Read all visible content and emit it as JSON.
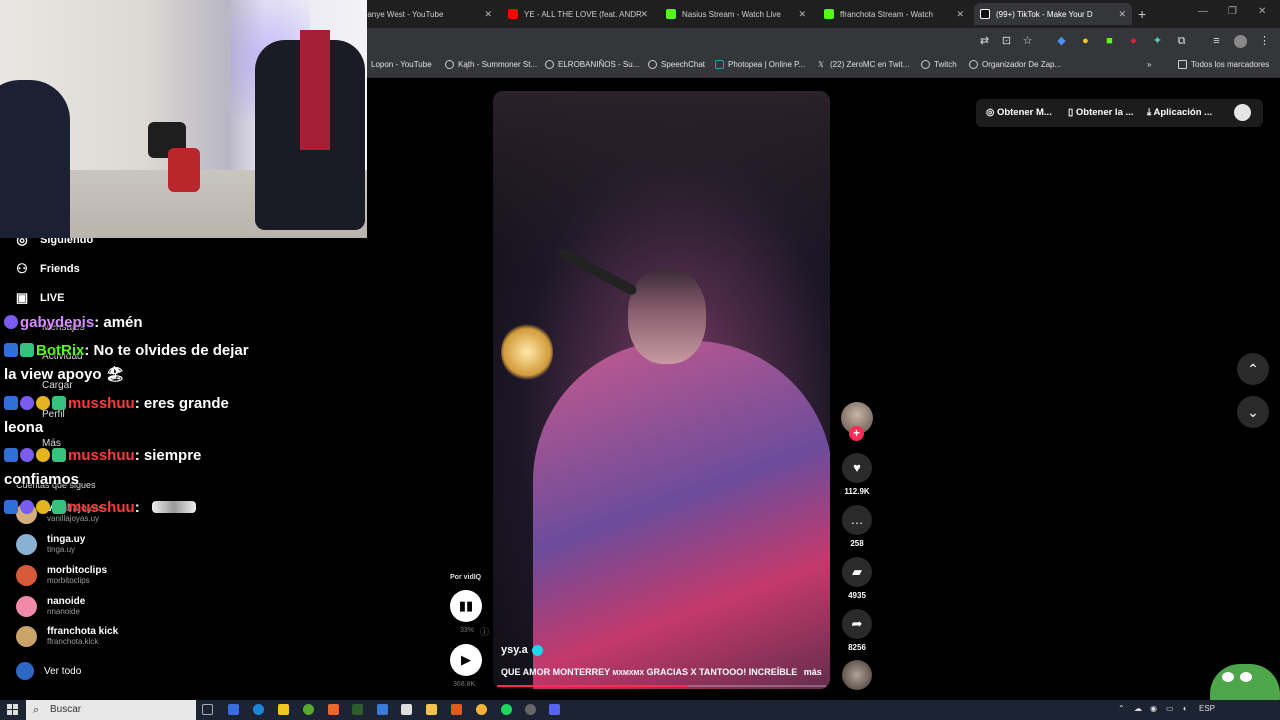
{
  "browser": {
    "tabs": [
      {
        "title": "Kanye West - YouTube",
        "color": "#ffffff"
      },
      {
        "title": "YE - ALL THE LOVE (feat. ANDR",
        "color": "#ff0000"
      },
      {
        "title": "Nasius Stream - Watch Live",
        "color": "#53fc18"
      },
      {
        "title": "ffranchota Stream - Watch",
        "color": "#53fc18"
      },
      {
        "title": "(99+) TikTok - Make Your D",
        "color": "#ffffff"
      }
    ],
    "new_tab": "+",
    "bookmarks": [
      "Lopon - YouTube",
      "Kąth - Summoner St...",
      "ELROBANIÑOS - Su...",
      "SpeechChat",
      "Photopea | Online P...",
      "(22) ZeroMC en Twit...",
      "Twitch",
      "Organizador De Zap...",
      "Todos los marcadores"
    ]
  },
  "sidebar": {
    "items": [
      {
        "label": "Siguiendo",
        "icon": "users-icon"
      },
      {
        "label": "Friends",
        "icon": "friends-icon"
      },
      {
        "label": "LIVE",
        "icon": "live-icon"
      }
    ],
    "ghost_items": [
      "Mensajes",
      "Actividad",
      "Cargar",
      "Perfil",
      "Más"
    ],
    "section_title": "Cuentas que sigues",
    "accounts": [
      {
        "name": "vanillajoyas",
        "handle": "vanillajoyas.uy",
        "color": "#d6b07a"
      },
      {
        "name": "tinga.uy",
        "handle": "tinga.uy",
        "color": "#8ab0d4"
      },
      {
        "name": "morbitoclips",
        "handle": "morbitoclips",
        "color": "#d65a3a"
      },
      {
        "name": "nanoide",
        "handle": "nnanoide",
        "color": "#f08aa8"
      },
      {
        "name": "ffranchota kick",
        "handle": "ffranchota.kick",
        "color": "#c9a46a"
      }
    ],
    "see_all": "Ver todo"
  },
  "chat": [
    {
      "user": "gabydepis",
      "user_color": "#d98cff",
      "text": ": amén"
    },
    {
      "user": "BotRix",
      "user_color": "#53fc18",
      "text": ": No te olvides de dejar la view apoyo 🏖"
    },
    {
      "user": "musshuu",
      "user_color": "#ff3b3b",
      "text": ": eres grande leona"
    },
    {
      "user": "musshuu",
      "user_color": "#ff3b3b",
      "text": ": siempre confiamos"
    },
    {
      "user": "musshuu",
      "user_color": "#ff3b3b",
      "text": ":"
    }
  ],
  "video": {
    "author": "ysy.a",
    "caption_main": "QUE AMOR MONTERREY",
    "caption_small": "MXMXMX",
    "caption_rest": "GRACIAS X TANTOOO! INCREÍBLE",
    "more": "más",
    "progress": 0.58,
    "playlist_label": "Por vidIQ",
    "stat_1": "33%",
    "stat_2": "368.8K"
  },
  "actions": {
    "likes": "112.9K",
    "comments": "258",
    "saves": "4935",
    "shares": "8256"
  },
  "top_buttons": {
    "coins": "Obtener M...",
    "app_link": "Obtener la ...",
    "app": "Aplicación ..."
  },
  "taskbar": {
    "search_placeholder": "Buscar",
    "language": "ESP"
  },
  "colors": {
    "tiktok_red": "#fe2c55",
    "verified": "#20d5ec",
    "kick_green": "#53fc18"
  }
}
